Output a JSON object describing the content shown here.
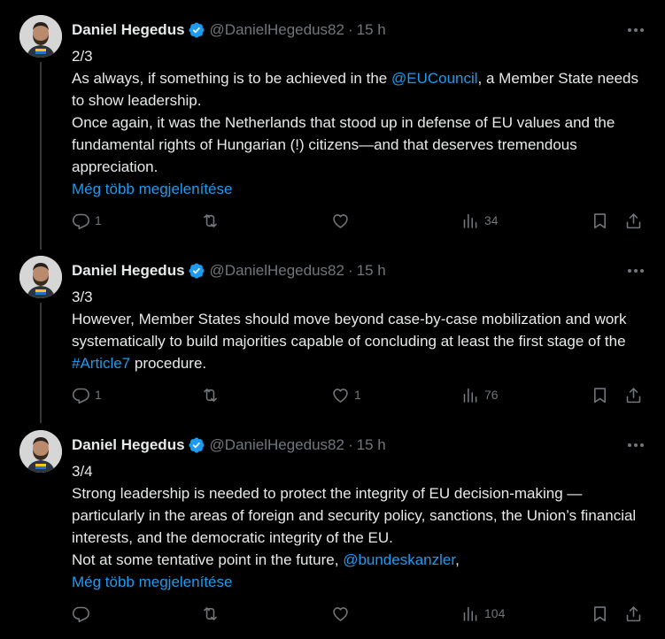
{
  "tweets": [
    {
      "author": "Daniel Hegedus",
      "handle": "@DanielHegedus82",
      "time": "15 h",
      "part": "2/3",
      "seg_1": "As always, if something is to be achieved in the ",
      "link_1": "@EUCouncil",
      "seg_2": ", a Member State needs to show leadership.",
      "para_2": "Once again, it was the Netherlands that stood up in defense of EU values and the fundamental rights of Hungarian (!) citizens—and that deserves tremendous appreciation.",
      "show_more": "Még több megjelenítése",
      "replies": "1",
      "reposts": "",
      "likes": "",
      "views": "34"
    },
    {
      "author": "Daniel Hegedus",
      "handle": "@DanielHegedus82",
      "time": "15 h",
      "part": "3/3",
      "seg_1": "However, Member States should move beyond case-by-case mobilization and work systematically to build majorities capable of concluding at least the first stage of the ",
      "link_1": "#Article7",
      "seg_2": " procedure.",
      "replies": "1",
      "reposts": "",
      "likes": "1",
      "views": "76"
    },
    {
      "author": "Daniel Hegedus",
      "handle": "@DanielHegedus82",
      "time": "15 h",
      "part": "3/4",
      "para_1": "Strong leadership is needed to protect the integrity of EU decision-making —particularly in the areas of foreign and security policy, sanctions, the Union’s financial interests, and the democratic integrity of the EU.",
      "seg_1": "Not at some tentative point in the future, ",
      "link_1": "@bundeskanzler",
      "seg_2": ",",
      "show_more": "Még több megjelenítése",
      "replies": "",
      "reposts": "",
      "likes": "",
      "views": "104"
    }
  ],
  "colors": {
    "background": "#000000",
    "text": "#e7e9ea",
    "secondary": "#71767b",
    "link": "#1d9bf0",
    "thread_line": "#333639"
  },
  "icons": [
    "verified-badge-icon",
    "more-icon",
    "reply-icon",
    "repost-icon",
    "like-icon",
    "views-icon",
    "bookmark-icon",
    "share-icon"
  ]
}
